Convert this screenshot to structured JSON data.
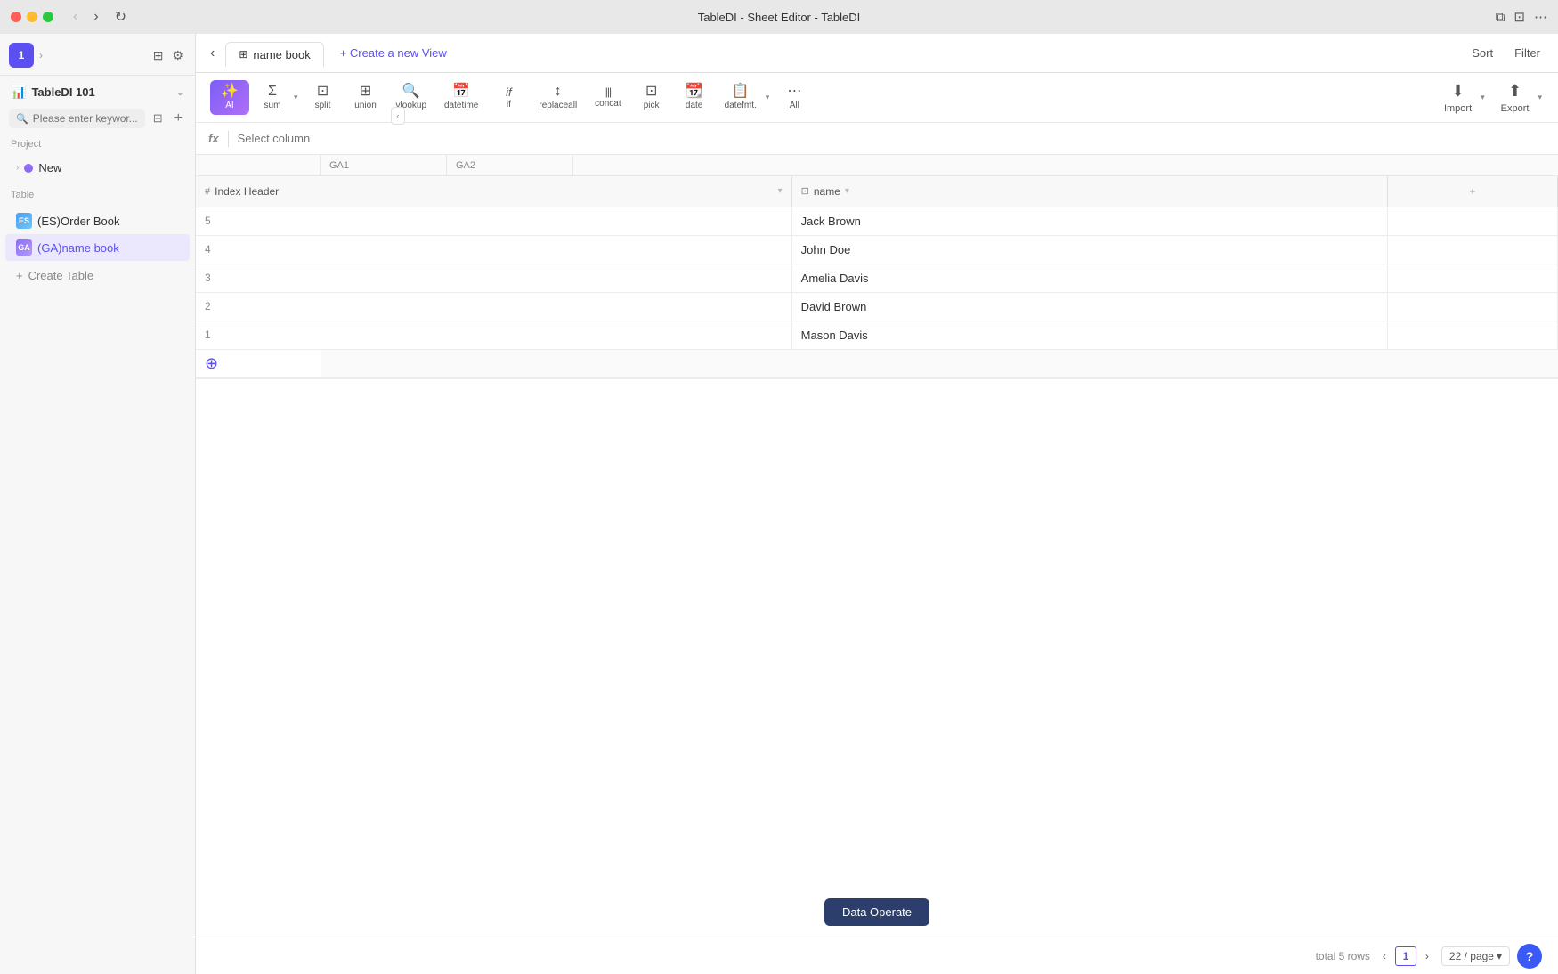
{
  "titlebar": {
    "title": "TableDI - Sheet Editor - TableDI",
    "back_label": "‹",
    "forward_label": "›",
    "refresh_label": "↻"
  },
  "sidebar": {
    "icon_label": "1",
    "workspace_name": "TableDI 101",
    "workspace_emoji": "📊",
    "search_placeholder": "Please enter keywor...",
    "project_label": "Project",
    "project_items": [
      {
        "label": "New",
        "color": "#8c6cf5"
      }
    ],
    "table_label": "Table",
    "table_items": [
      {
        "prefix": "ES",
        "label": "(ES)Order Book",
        "active": false
      },
      {
        "prefix": "GA",
        "label": "(GA)name book",
        "active": true
      }
    ],
    "create_table_label": "Create Table"
  },
  "tabs": {
    "active_tab": "name book",
    "new_view_label": "+ Create a new View"
  },
  "toolbar": {
    "tools": [
      {
        "id": "ai",
        "icon": "✨",
        "label": "AI",
        "active": true
      },
      {
        "id": "sum",
        "icon": "Σ",
        "label": "sum",
        "active": false
      },
      {
        "id": "split",
        "icon": "⊠",
        "label": "split",
        "active": false
      },
      {
        "id": "union",
        "icon": "⊞",
        "label": "union",
        "active": false
      },
      {
        "id": "vlookup",
        "icon": "🔍",
        "label": "vlookup",
        "active": false
      },
      {
        "id": "datetime",
        "icon": "📅",
        "label": "datetime",
        "active": false
      },
      {
        "id": "if",
        "icon": "if",
        "label": "if",
        "active": false
      },
      {
        "id": "replaceall",
        "icon": "↕",
        "label": "replaceall",
        "active": false
      },
      {
        "id": "concat",
        "icon": "|||",
        "label": "concat",
        "active": false
      },
      {
        "id": "pick",
        "icon": "⊡",
        "label": "pick",
        "active": false
      },
      {
        "id": "date",
        "icon": "📆",
        "label": "date",
        "active": false
      },
      {
        "id": "datefmt",
        "icon": "📋",
        "label": "datefmt.",
        "active": false
      },
      {
        "id": "all",
        "icon": "⋯",
        "label": "All",
        "active": false
      }
    ],
    "import_label": "Import",
    "export_label": "Export"
  },
  "formula_bar": {
    "fx_label": "fx",
    "placeholder": "Select column"
  },
  "col_groups": {
    "group1": "GA1",
    "group2": "GA2"
  },
  "table": {
    "columns": [
      {
        "id": "index",
        "label": "Index Header",
        "type_icon": "#"
      },
      {
        "id": "name",
        "label": "name",
        "type_icon": "⊡"
      }
    ],
    "rows": [
      {
        "index": "5",
        "name": "Jack Brown"
      },
      {
        "index": "4",
        "name": "John Doe"
      },
      {
        "index": "3",
        "name": "Amelia Davis"
      },
      {
        "index": "2",
        "name": "David Brown"
      },
      {
        "index": "1",
        "name": "Mason Davis"
      }
    ]
  },
  "status_bar": {
    "total_rows_label": "total 5 rows",
    "current_page": "1",
    "page_size": "22 / page",
    "help_label": "?"
  },
  "sort_label": "Sort",
  "filter_label": "Filter",
  "data_operate_label": "Data Operate"
}
